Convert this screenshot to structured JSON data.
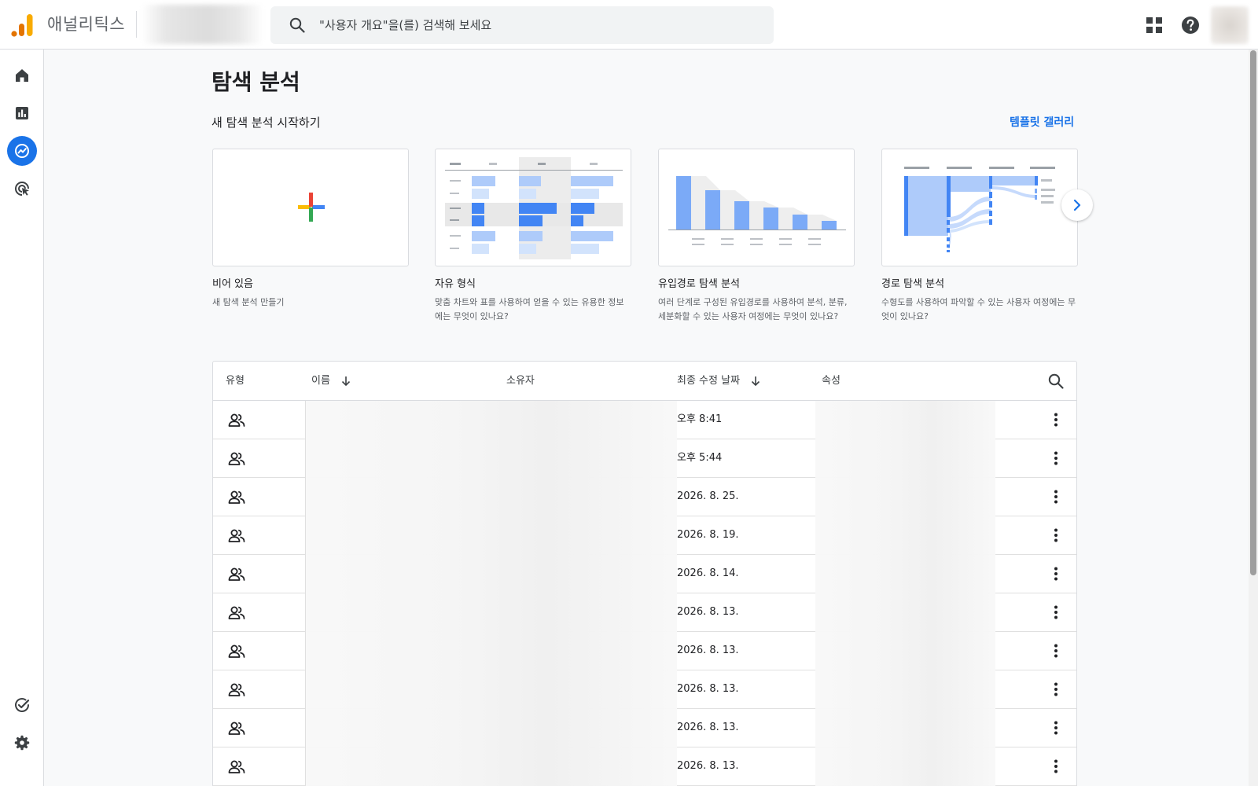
{
  "header": {
    "app_name": "애널리틱스",
    "search_placeholder": "\"사용자 개요\"을(를) 검색해 보세요",
    "brand_colors": {
      "orange_dark": "#e37400",
      "orange_light": "#f9ab00",
      "accent": "#1a73e8"
    }
  },
  "nav": {
    "items": [
      {
        "icon": "home-icon"
      },
      {
        "icon": "reports-icon"
      },
      {
        "icon": "explore-icon",
        "active": true
      },
      {
        "icon": "advertising-icon"
      }
    ],
    "bottom": [
      {
        "icon": "admin-check-icon"
      },
      {
        "icon": "settings-gear-icon"
      }
    ]
  },
  "page": {
    "title": "탐색 분석",
    "section_title": "새 탐색 분석 시작하기",
    "template_gallery": "템플릿 갤러리"
  },
  "templates": [
    {
      "title": "비어 있음",
      "description": "새 탐색 분석 만들기"
    },
    {
      "title": "자유 형식",
      "description": "맞춤 차트와 표를 사용하여 얻을 수 있는 유용한 정보에는 무엇이 있나요?"
    },
    {
      "title": "유입경로 탐색 분석",
      "description": "여러 단계로 구성된 유입경로를 사용하여 분석, 분류, 세분화할 수 있는 사용자 여정에는 무엇이 있나요?"
    },
    {
      "title": "경로 탐색 분석",
      "description": "수형도를 사용하여 파악할 수 있는 사용자 여정에는 무엇이 있나요?"
    }
  ],
  "table": {
    "columns": {
      "type": "유형",
      "name": "이름",
      "owner": "소유자",
      "modified": "최종 수정 날짜",
      "property": "속성"
    },
    "rows": [
      {
        "modified": "오후 8:41"
      },
      {
        "modified": "오후 5:44"
      },
      {
        "modified": "2026. 8. 25."
      },
      {
        "modified": "2026. 8. 19."
      },
      {
        "modified": "2026. 8. 14."
      },
      {
        "modified": "2026. 8. 13."
      },
      {
        "modified": "2026. 8. 13."
      },
      {
        "modified": "2026. 8. 13."
      },
      {
        "modified": "2026. 8. 13."
      },
      {
        "modified": "2026. 8. 13."
      }
    ]
  }
}
